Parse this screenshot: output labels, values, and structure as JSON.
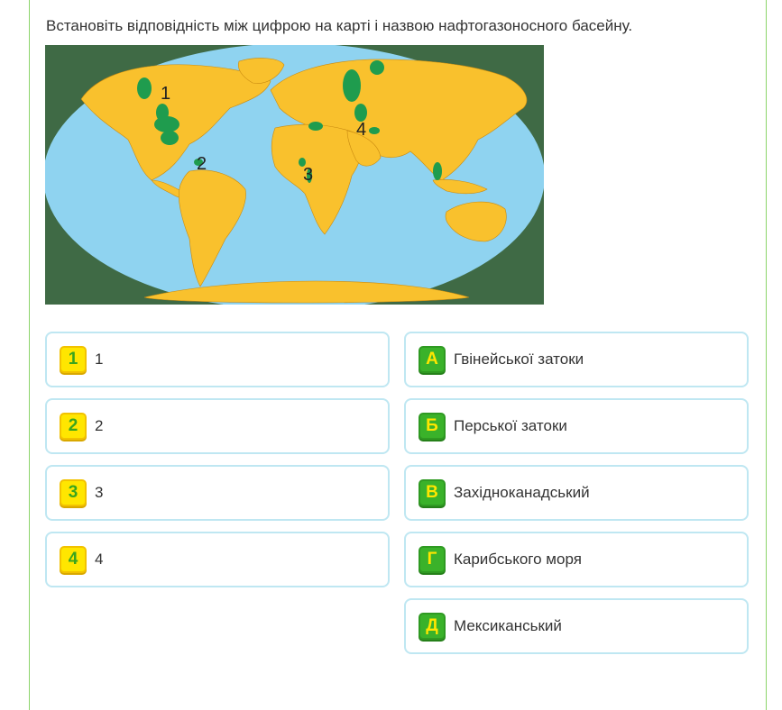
{
  "question": "Встановіть відповідність між цифрою на карті і назвою нафтогазоносного басейну.",
  "map": {
    "labels": [
      "1",
      "2",
      "3",
      "4"
    ],
    "colors": {
      "ocean": "#8fd3f0",
      "land": "#f9c12d",
      "oil": "#1f9c4e",
      "frame": "#3f6a45"
    }
  },
  "left_items": [
    {
      "badge": "1",
      "text": "1"
    },
    {
      "badge": "2",
      "text": "2"
    },
    {
      "badge": "3",
      "text": "3"
    },
    {
      "badge": "4",
      "text": "4"
    }
  ],
  "right_items": [
    {
      "badge": "А",
      "text": "Гвінейської затоки"
    },
    {
      "badge": "Б",
      "text": "Перської затоки"
    },
    {
      "badge": "В",
      "text": "Західноканадський"
    },
    {
      "badge": "Г",
      "text": "Карибського моря"
    },
    {
      "badge": "Д",
      "text": "Мексиканський"
    }
  ],
  "colors": {
    "accent_green": "#3ab22a",
    "accent_yellow": "#ffe600",
    "card_border": "#bfe7f2",
    "frame_border": "#8bd46a"
  }
}
